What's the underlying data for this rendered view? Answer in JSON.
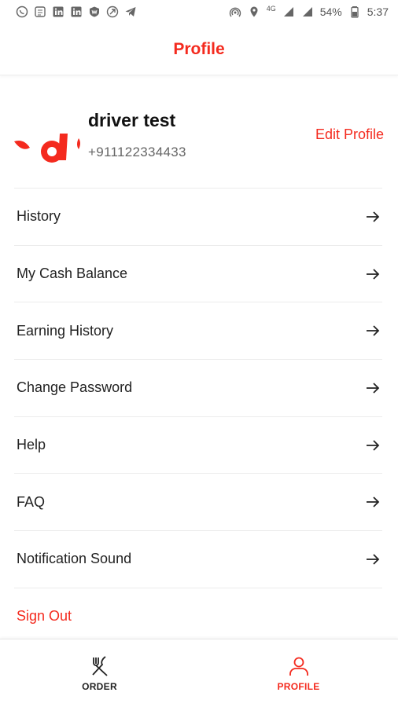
{
  "status_bar": {
    "left_icons": [
      "whatsapp-icon",
      "calendar-icon",
      "linkedin-icon",
      "linkedin-icon",
      "shield-w-icon",
      "circle-arrow-icon",
      "telegram-icon"
    ],
    "network": "4G",
    "battery": "54%",
    "time": "5:37"
  },
  "header": {
    "title": "Profile"
  },
  "profile": {
    "name": "driver test",
    "phone": "+911122334433",
    "edit_label": "Edit Profile"
  },
  "menu": {
    "items": [
      {
        "label": "History"
      },
      {
        "label": "My Cash Balance"
      },
      {
        "label": "Earning History"
      },
      {
        "label": "Change Password"
      },
      {
        "label": "Help"
      },
      {
        "label": "FAQ"
      },
      {
        "label": "Notification Sound"
      }
    ],
    "signout_label": "Sign Out"
  },
  "bottom_nav": {
    "order_label": "ORDER",
    "profile_label": "PROFILE",
    "active": "PROFILE"
  },
  "colors": {
    "accent": "#f42a1e",
    "text": "#222222",
    "muted": "#666666"
  }
}
